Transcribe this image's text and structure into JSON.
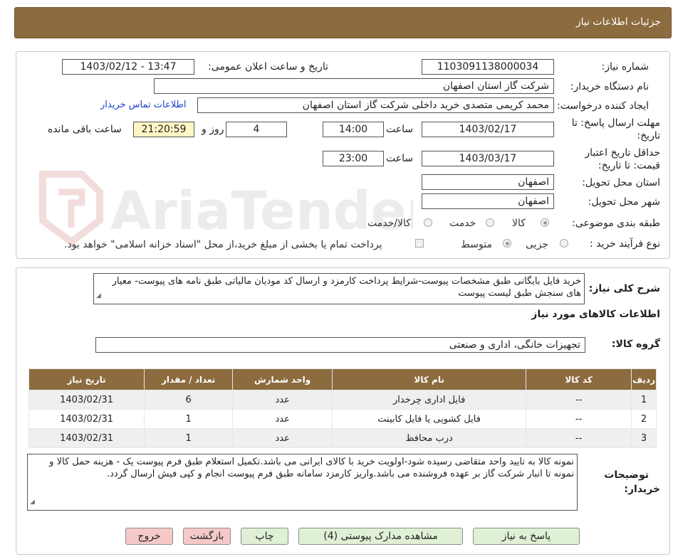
{
  "header": {
    "title": "جزئيات اطلاعات نياز"
  },
  "form": {
    "need_number_label": "شماره نیاز:",
    "need_number": "1103091138000034",
    "announce_label": "تاریخ و ساعت اعلان عمومی:",
    "announce_value": "1403/02/12 - 13:47",
    "buyer_org_label": "نام دستگاه خریدار:",
    "buyer_org": "شرکت گاز استان اصفهان",
    "creator_label": "ایجاد کننده درخواست:",
    "creator": "محمد کریمی متصدی خرید داخلی شرکت گاز استان اصفهان",
    "contact_link": "اطلاعات تماس خریدار",
    "deadline_label": "مهلت ارسال پاسخ: تا تاریخ:",
    "deadline_date": "1403/02/17",
    "time_label": "ساعت",
    "deadline_time": "14:00",
    "days_value": "4",
    "days_label": "روز و",
    "remaining_time": "21:20:59",
    "remaining_label": "ساعت باقی مانده",
    "validity_label": "حداقل تاریخ اعتبار قیمت: تا تاریخ:",
    "validity_date": "1403/03/17",
    "validity_time": "23:00",
    "province_label": "استان محل تحویل:",
    "province": "اصفهان",
    "city_label": "شهر محل تحویل:",
    "city": "اصفهان",
    "category_label": "طبقه بندی موضوعی:",
    "category_options": [
      "کالا",
      "خدمت",
      "کالا/خدمت"
    ],
    "category_selected": "کالا",
    "process_label": "نوع فرآیند خرید :",
    "process_options": [
      "جزیی",
      "متوسط"
    ],
    "process_selected": "متوسط",
    "payment_note": "پرداخت تمام یا بخشی از مبلغ خرید،از محل \"اسناد خزانه اسلامی\" خواهد بود."
  },
  "general": {
    "summary_label": "شرح کلی نیاز:",
    "summary_text": "خرید فایل بایگانی طبق مشخصات پیوست-شرایط پرداخت کارمزد و ارسال کد مودیان مالیاتی طبق نامه های پیوست- معیار های سنجش طبق لیست پیوست",
    "goods_info_title": "اطلاعات کالاهای مورد نیاز",
    "group_label": "گروه کالا:",
    "group_value": "تجهیزات خانگی، اداری و صنعتی"
  },
  "table": {
    "headers": [
      "ردیف",
      "کد کالا",
      "نام کالا",
      "واحد شمارش",
      "تعداد / مقدار",
      "تاریخ نیاز"
    ],
    "rows": [
      [
        "1",
        "--",
        "فایل اداری چرخدار",
        "عدد",
        "6",
        "1403/02/31"
      ],
      [
        "2",
        "--",
        "فایل کشویی یا فایل کابینت",
        "عدد",
        "1",
        "1403/02/31"
      ],
      [
        "3",
        "--",
        "درب محافظ",
        "عدد",
        "1",
        "1403/02/31"
      ]
    ]
  },
  "buyer_notes": {
    "label_line1": "توضیحات",
    "label_line2": "خریدار:",
    "text": "نمونه کالا به تایید واحد متقاضی رسیده شود-اولویت خرید با کالای ایرانی می باشد.تکمیل استعلام طبق فرم پیوست یک - هزینه حمل کالا و نمونه تا انبار شرکت گاز بر عهده فروشنده می باشد.واریز کارمزد سامانه طبق فرم پیوست انجام و کپی فیش ارسال گردد."
  },
  "buttons": {
    "reply": "پاسخ به نیاز",
    "attachments": "مشاهده مدارک پیوستی (4)",
    "print": "چاپ",
    "back": "بازگشت",
    "exit": "خروج"
  },
  "watermark": {
    "text": "AriaTender.neT"
  },
  "colors": {
    "header_bg": "#8c6b3f",
    "button_green": "#dff0d5",
    "button_pink": "#f6c9c9",
    "remaining_bg": "#fff6c4"
  }
}
